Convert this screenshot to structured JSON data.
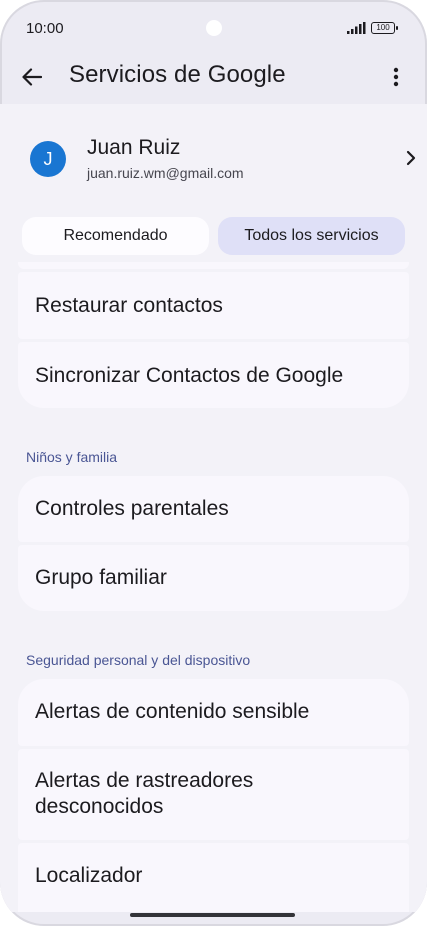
{
  "status_bar": {
    "time": "10:00",
    "battery": "100"
  },
  "app_bar": {
    "title": "Servicios de Google"
  },
  "account": {
    "initial": "J",
    "name": "Juan Ruiz",
    "email": "juan.ruiz.wm@gmail.com"
  },
  "tabs": [
    {
      "label": "Recomendado",
      "selected": false
    },
    {
      "label": "Todos los servicios",
      "selected": true
    }
  ],
  "group_contacts": {
    "items": [
      "Restaurar contactos",
      "Sincronizar Contactos de Google"
    ]
  },
  "section_family": {
    "header": "Niños y familia",
    "items": [
      "Controles parentales",
      "Grupo familiar"
    ]
  },
  "section_safety": {
    "header": "Seguridad personal y del dispositivo",
    "items": [
      "Alertas de contenido sensible",
      "Alertas de rastreadores desconocidos",
      "Localizador"
    ]
  },
  "colors": {
    "accent": "#4a5694",
    "avatar": "#1976d2",
    "tab_selected": "#dfe0f7",
    "card": "#f9f7fd"
  }
}
